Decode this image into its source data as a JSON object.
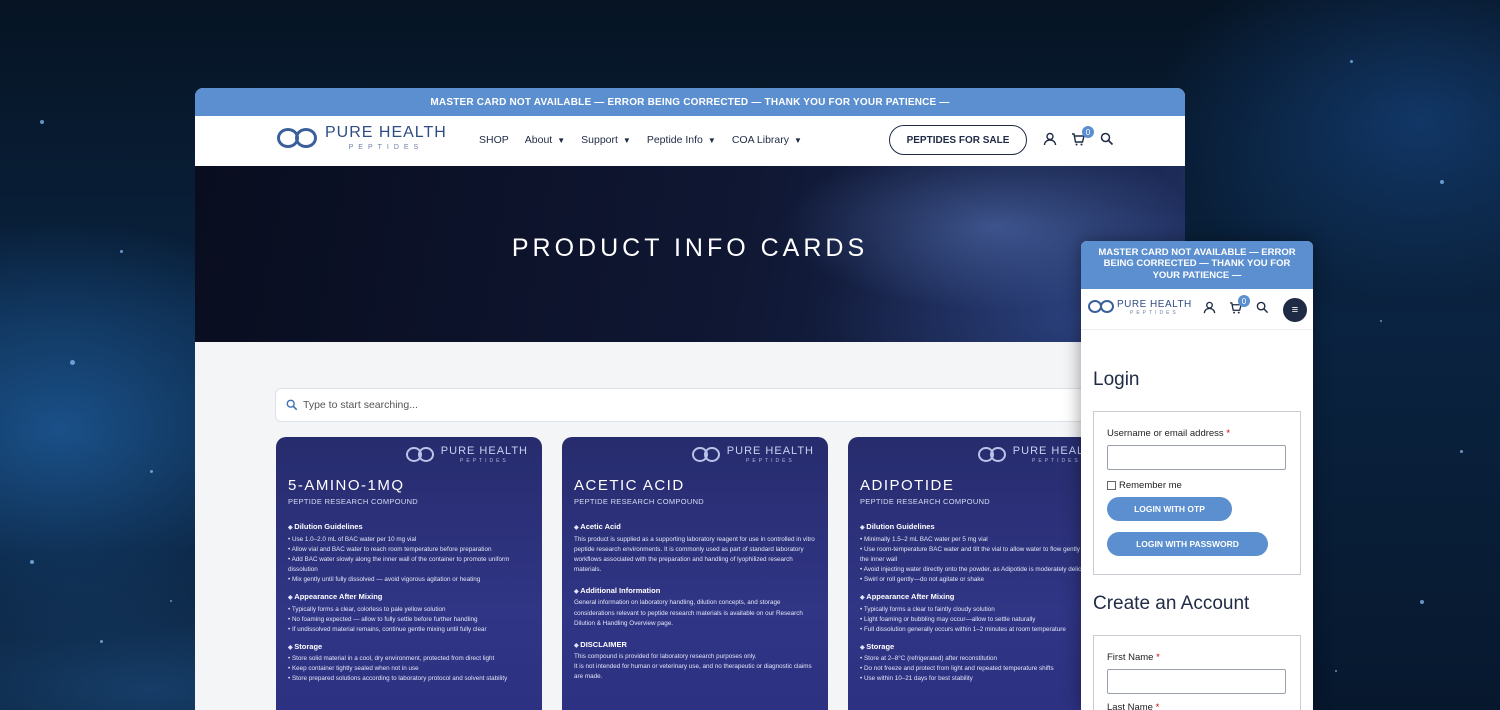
{
  "desktop": {
    "announcement": "MASTER CARD NOT AVAILABLE — ERROR BEING CORRECTED — THANK YOU FOR YOUR PATIENCE —",
    "logo": {
      "line1": "PURE HEALTH",
      "line2": "PEPTIDES"
    },
    "menu": [
      {
        "label": "SHOP",
        "dropdown": false
      },
      {
        "label": "About",
        "dropdown": true
      },
      {
        "label": "Support",
        "dropdown": true
      },
      {
        "label": "Peptide Info",
        "dropdown": true
      },
      {
        "label": "COA Library",
        "dropdown": true
      }
    ],
    "cta_label": "PEPTIDES FOR SALE",
    "cart_count": "0",
    "hero_title": "PRODUCT INFO CARDS",
    "search_placeholder": "Type to start searching...",
    "cards": [
      {
        "title": "5-AMINO-1MQ",
        "subtitle": "PEPTIDE RESEARCH COMPOUND",
        "sections": [
          {
            "heading": "Dilution Guidelines",
            "lines": [
              "• Use 1.0–2.0 mL of BAC water per 10 mg vial",
              "• Allow vial and BAC water to reach room temperature before preparation",
              "• Add BAC water slowly along the inner wall of the container to promote uniform dissolution",
              "• Mix gently until fully dissolved — avoid vigorous agitation or heating"
            ]
          },
          {
            "heading": "Appearance After Mixing",
            "lines": [
              "• Typically forms a clear, colorless to pale yellow solution",
              "• No foaming expected — allow to fully settle before further handling",
              "• If undissolved material remains, continue gentle mixing until fully clear"
            ]
          },
          {
            "heading": "Storage",
            "lines": [
              "• Store solid material in a cool, dry environment, protected from direct light",
              "• Keep container tightly sealed when not in use",
              "• Store prepared solutions according to laboratory protocol and solvent stability"
            ]
          }
        ]
      },
      {
        "title": "ACETIC ACID",
        "subtitle": "PEPTIDE RESEARCH COMPOUND",
        "sections": [
          {
            "heading": "Acetic Acid",
            "lines": [
              "This product is supplied as a supporting laboratory reagent for use in controlled in vitro peptide research environments. It is commonly used as part of standard laboratory workflows associated with the preparation and handling of lyophilized research materials."
            ]
          },
          {
            "heading": "Additional Information",
            "lines": [
              "General information on laboratory handling, dilution concepts, and storage considerations relevant to peptide research materials is available on our Research Dilution & Handling Overview page."
            ]
          },
          {
            "heading": "DISCLAIMER",
            "lines": [
              "This compound is provided for laboratory research purposes only.",
              "It is not intended for human or veterinary use, and no therapeutic or diagnostic claims are made."
            ]
          }
        ]
      },
      {
        "title": "ADIPOTIDE",
        "subtitle": "PEPTIDE RESEARCH COMPOUND",
        "sections": [
          {
            "heading": "Dilution Guidelines",
            "lines": [
              "• Minimally 1.5–2 mL BAC water per 5 mg vial",
              "• Use room-temperature BAC water and tilt the vial to allow water to flow gently along the inner wall",
              "• Avoid injecting water directly onto the powder, as Adipotide is moderately delicate",
              "• Swirl or roll gently—do not agitate or shake"
            ]
          },
          {
            "heading": "Appearance After Mixing",
            "lines": [
              "• Typically forms a clear to faintly cloudy solution",
              "• Light foaming or bubbling may occur—allow to settle naturally",
              "• Full dissolution generally occurs within 1–2 minutes at room temperature"
            ]
          },
          {
            "heading": "Storage",
            "lines": [
              "• Store at 2–8°C (refrigerated) after reconstitution",
              "• Do not freeze and protect from light and repeated temperature shifts",
              "• Use within 10–21 days for best stability"
            ]
          }
        ]
      }
    ]
  },
  "mobile": {
    "announcement": "MASTER CARD NOT AVAILABLE — ERROR BEING CORRECTED — THANK YOU FOR YOUR PATIENCE —",
    "logo": {
      "line1": "PURE HEALTH",
      "line2": "PEPTIDES"
    },
    "cart_count": "0",
    "login_heading": "Login",
    "username_label": "Username or email address",
    "required_mark": "*",
    "remember_label": "Remember me",
    "otp_button": "LOGIN WITH OTP",
    "password_button": "LOGIN WITH PASSWORD",
    "create_heading": "Create an Account",
    "first_name_label": "First Name",
    "last_name_label": "Last Name"
  },
  "colors": {
    "accent": "#5b8fcf",
    "navy": "#1f2a44",
    "card": "#2c3080"
  }
}
